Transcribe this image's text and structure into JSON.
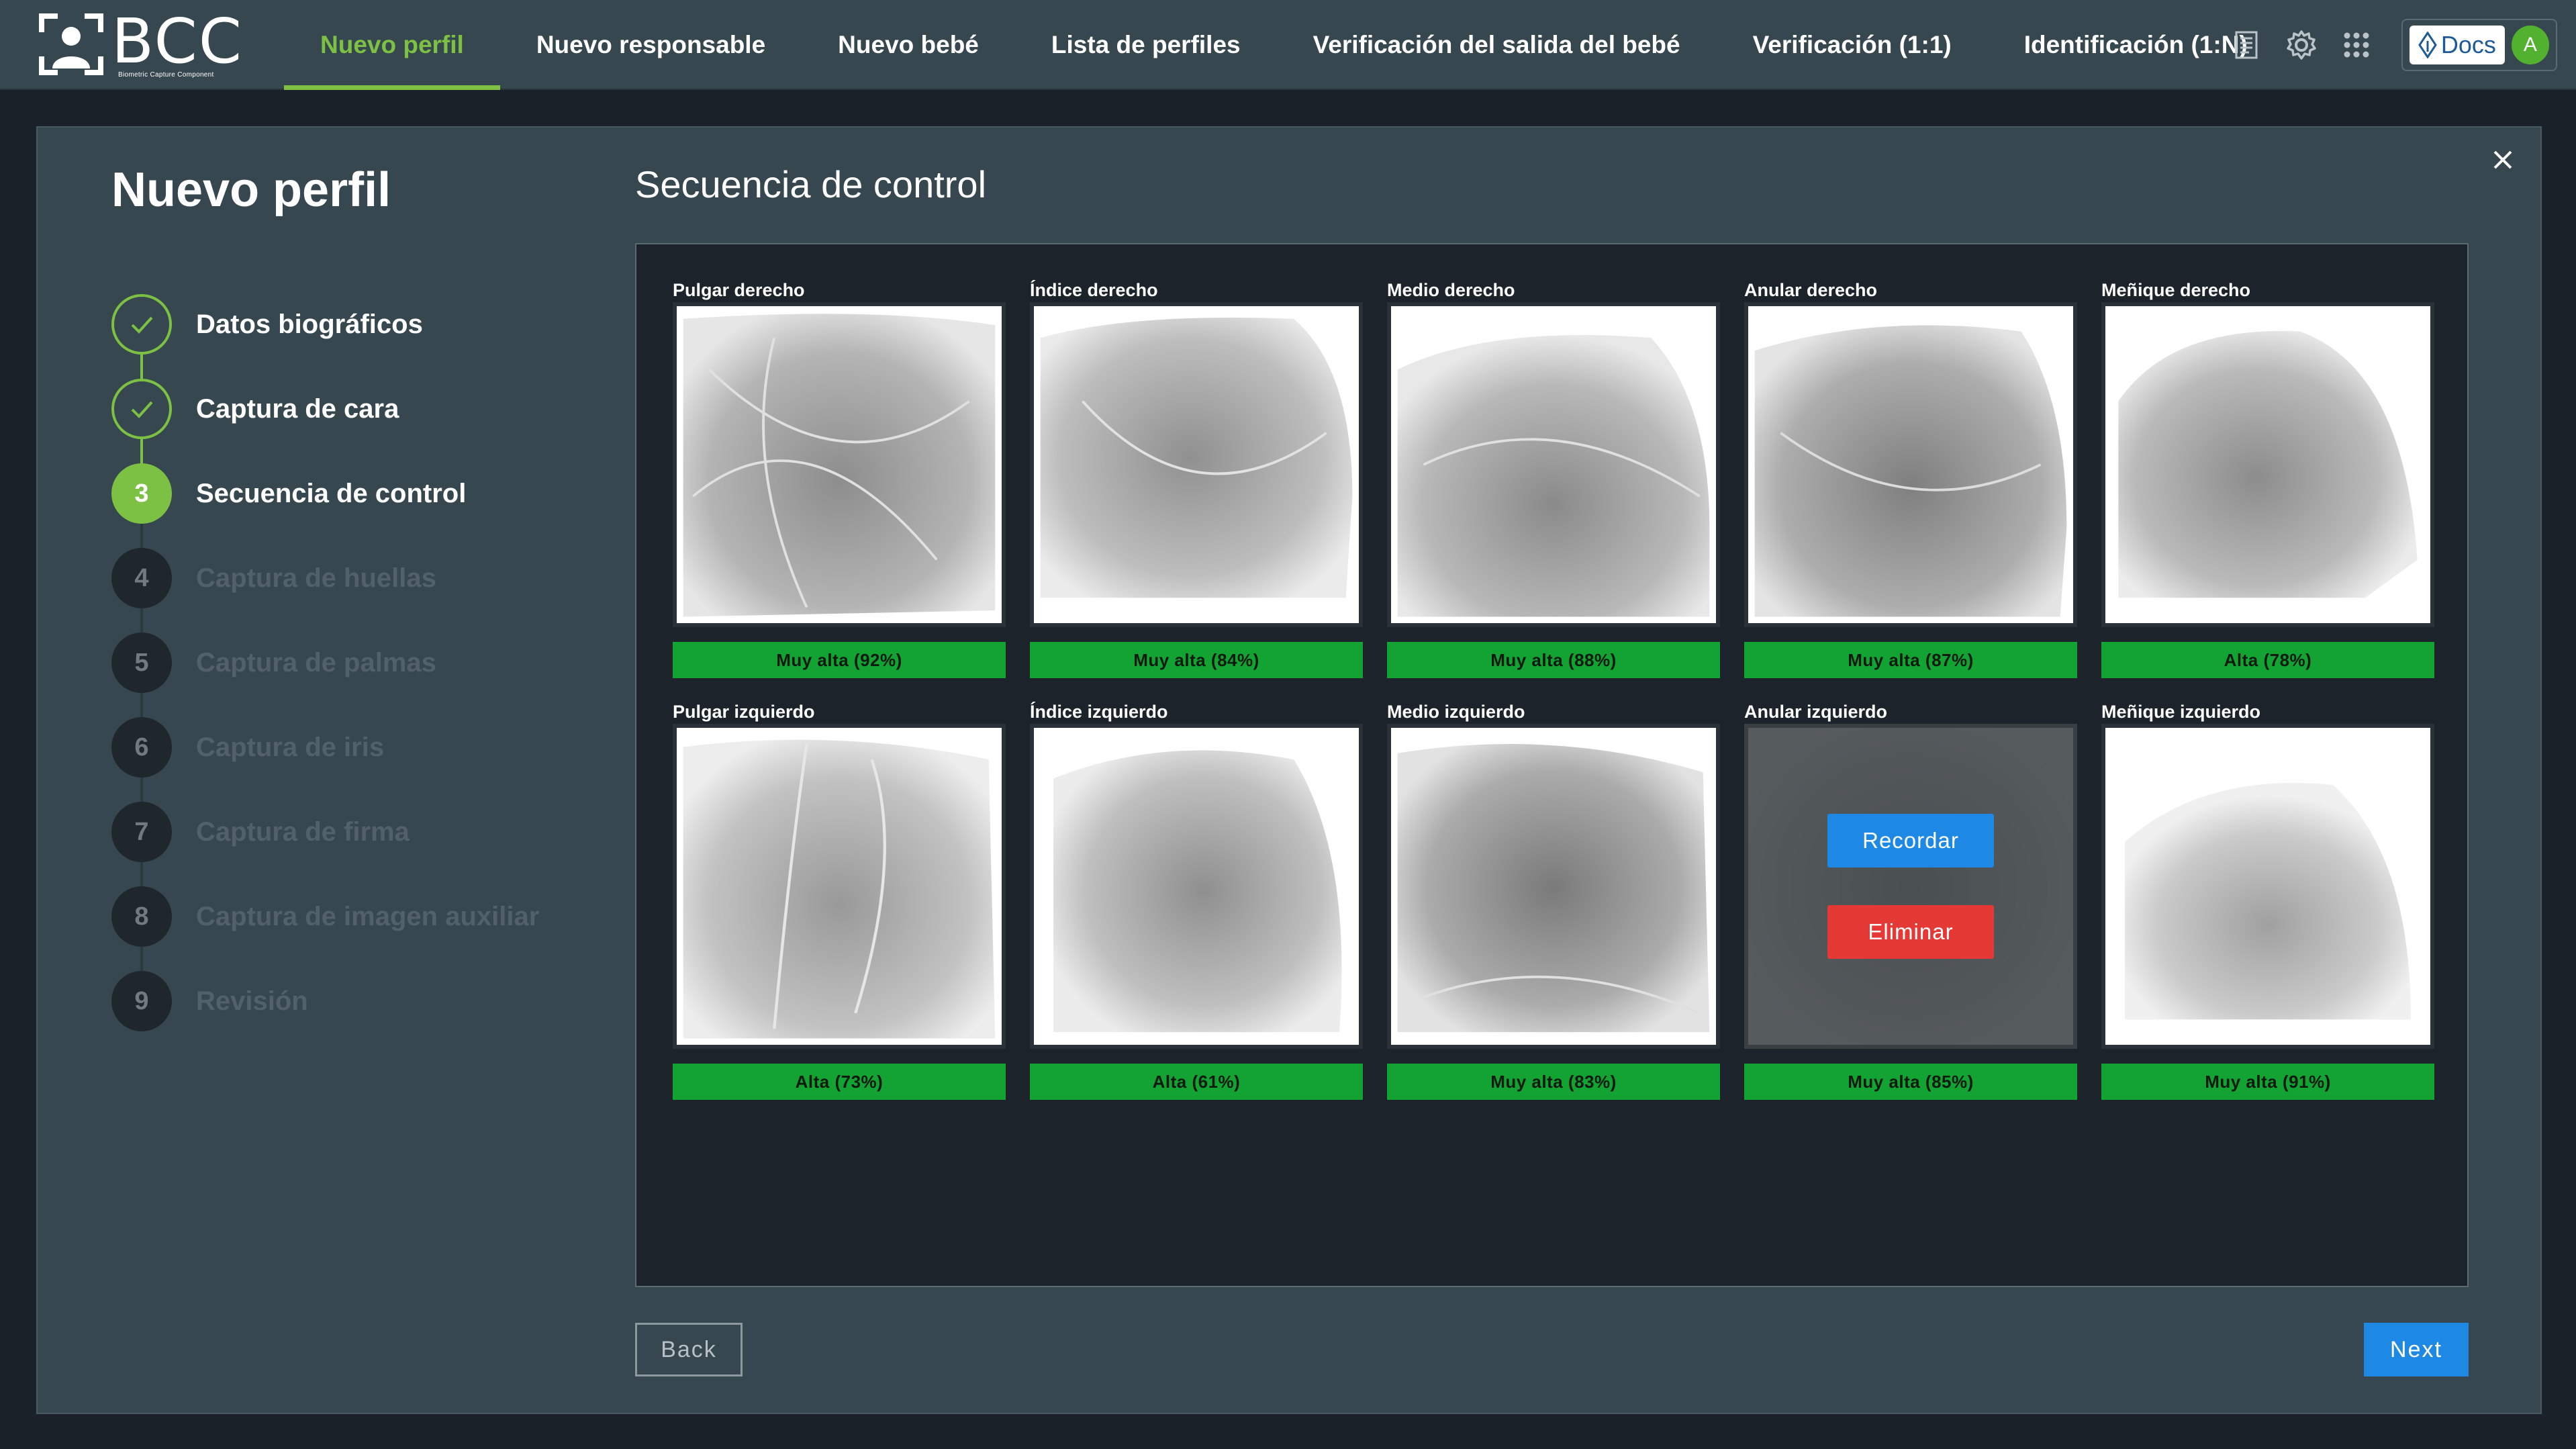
{
  "brand": {
    "name": "BCC",
    "subtitle": "Biometric Capture Component"
  },
  "nav": {
    "items": [
      {
        "label": "Nuevo perfil",
        "active": true
      },
      {
        "label": "Nuevo responsable",
        "active": false
      },
      {
        "label": "Nuevo bebé",
        "active": false
      },
      {
        "label": "Lista de perfiles",
        "active": false
      },
      {
        "label": "Verificación del salida del bebé",
        "active": false
      },
      {
        "label": "Verificación (1:1)",
        "active": false
      },
      {
        "label": "Identificación (1:N)",
        "active": false
      }
    ],
    "icons": [
      "document-icon",
      "gear-icon",
      "apps-grid-icon"
    ],
    "docs_label": "Docs",
    "avatar_initial": "A"
  },
  "colors": {
    "accent_green": "#7cc144",
    "quality_green": "#12a332",
    "primary_blue": "#1e88e5",
    "danger_red": "#e53935",
    "panel_bg": "#37474f"
  },
  "page": {
    "title": "Nuevo perfil",
    "section_title": "Secuencia de control"
  },
  "steps": [
    {
      "number": "1",
      "label": "Datos biográficos",
      "status": "done"
    },
    {
      "number": "2",
      "label": "Captura de cara",
      "status": "done"
    },
    {
      "number": "3",
      "label": "Secuencia de control",
      "status": "current"
    },
    {
      "number": "4",
      "label": "Captura de huellas",
      "status": "pending"
    },
    {
      "number": "5",
      "label": "Captura de palmas",
      "status": "pending"
    },
    {
      "number": "6",
      "label": "Captura de iris",
      "status": "pending"
    },
    {
      "number": "7",
      "label": "Captura de firma",
      "status": "pending"
    },
    {
      "number": "8",
      "label": "Captura de imagen auxiliar",
      "status": "pending"
    },
    {
      "number": "9",
      "label": "Revisión",
      "status": "pending"
    }
  ],
  "fingers": [
    {
      "label": "Pulgar derecho",
      "quality": "Muy alta (92%)",
      "score": 92
    },
    {
      "label": "Índice derecho",
      "quality": "Muy alta (84%)",
      "score": 84
    },
    {
      "label": "Medio derecho",
      "quality": "Muy alta (88%)",
      "score": 88
    },
    {
      "label": "Anular derecho",
      "quality": "Muy alta (87%)",
      "score": 87
    },
    {
      "label": "Meñique derecho",
      "quality": "Alta (78%)",
      "score": 78
    },
    {
      "label": "Pulgar izquierdo",
      "quality": "Alta (73%)",
      "score": 73
    },
    {
      "label": "Índice izquierdo",
      "quality": "Alta (61%)",
      "score": 61
    },
    {
      "label": "Medio izquierdo",
      "quality": "Muy alta (83%)",
      "score": 83
    },
    {
      "label": "Anular izquierdo",
      "quality": "Muy alta (85%)",
      "score": 85,
      "hovered": true
    },
    {
      "label": "Meñique izquierdo",
      "quality": "Muy alta (91%)",
      "score": 91
    }
  ],
  "overlay": {
    "recall_label": "Recordar",
    "delete_label": "Eliminar"
  },
  "footer": {
    "back_label": "Back",
    "next_label": "Next"
  }
}
